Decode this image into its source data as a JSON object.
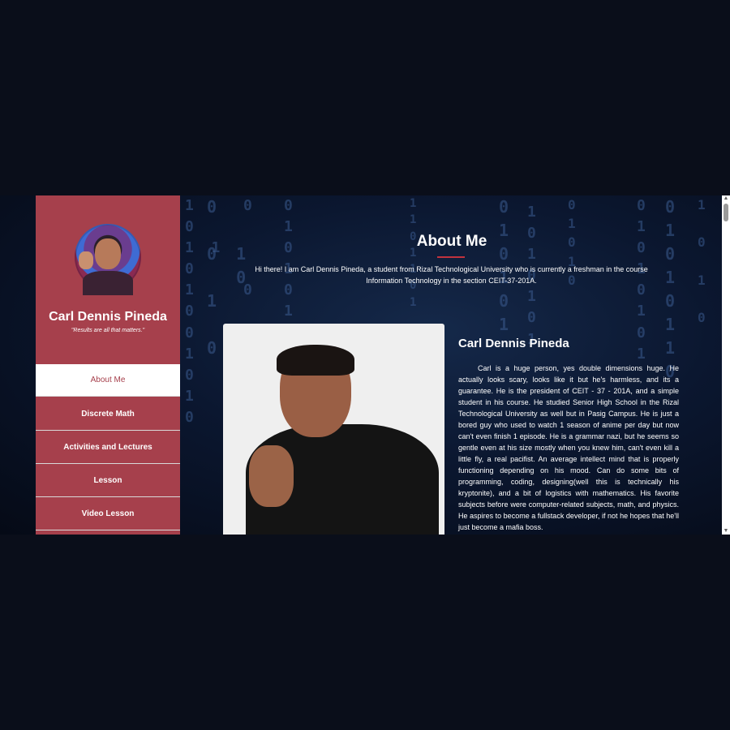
{
  "sidebar": {
    "name": "Carl Dennis Pineda",
    "motto": "\"Results are all that matters.\"",
    "nav": [
      {
        "label": "About Me",
        "active": true
      },
      {
        "label": "Discrete Math",
        "active": false
      },
      {
        "label": "Activities and Lectures",
        "active": false
      },
      {
        "label": "Lesson",
        "active": false
      },
      {
        "label": "Video Lesson",
        "active": false
      }
    ]
  },
  "main": {
    "title": "About Me",
    "intro": "Hi there! I am Carl Dennis Pineda, a student from Rizal Technological University who is currently a freshman in the course Information Technology in the section CEIT-37-201A.",
    "bio_name": "Carl Dennis Pineda",
    "bio": "Carl is a huge person, yes double dimensions huge. He actually looks scary, looks like it but he's harmless, and its a guarantee. He is the president of CEIT - 37 - 201A, and a simple student in his course. He studied Senior High School in the Rizal Technological University as well but in Pasig Campus. He is just a bored guy who used to watch 1 season of anime per day but now can't even finish 1 episode. He is a grammar nazi, but he seems so gentle even at his size mostly when you knew him, can't even kill a little fly, a real pacifist. An average intellect mind that is properly functioning depending on his mood. Can do some bits of programming, coding, designing(well this is technically his kryptonite), and a bit of logistics with mathematics. His favorite subjects before were computer-related subjects, math, and physics. He aspires to become a fullstack developer, if not he hopes that he'll just become a mafia boss."
  },
  "colors": {
    "sidebar": "#a6404c",
    "accent": "#c2333e",
    "page_background": "#0a0e1a"
  }
}
